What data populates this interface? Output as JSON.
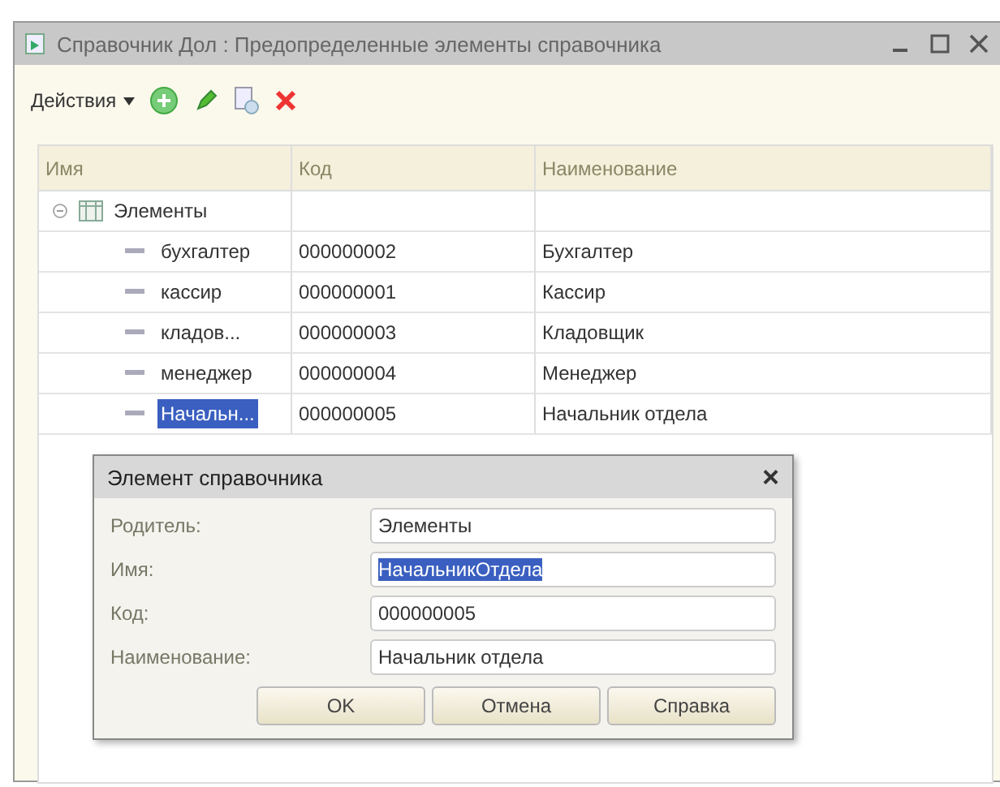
{
  "window": {
    "title": "Справочник Дол : Предопределенные элементы справочника"
  },
  "toolbar": {
    "actions_label": "Действия"
  },
  "table": {
    "columns": [
      "Имя",
      "Код",
      "Наименование"
    ],
    "tree": [
      {
        "name": "Элементы",
        "expanded": true,
        "selected": false,
        "children": [
          {
            "name": "бухгалтер",
            "code": "000000002",
            "title": "Бухгалтер",
            "selected": false
          },
          {
            "name": "кассир",
            "code": "000000001",
            "title": "Кассир",
            "selected": false
          },
          {
            "name": "кладов...",
            "code": "000000003",
            "title": "Кладовщик",
            "selected": false
          },
          {
            "name": "менеджер",
            "code": "000000004",
            "title": "Менеджер",
            "selected": false
          },
          {
            "name": "Начальн...",
            "code": "000000005",
            "title": "Начальник отдела",
            "selected": true
          }
        ]
      }
    ]
  },
  "dialog": {
    "title": "Элемент справочника",
    "close": "×",
    "fields": [
      {
        "label": "Родитель:",
        "value": "Элементы",
        "selected": false
      },
      {
        "label": "Имя:",
        "value": "НачальникОтдела",
        "selected": true
      },
      {
        "label": "Код:",
        "value": "000000005",
        "selected": false
      },
      {
        "label": "Наименование:",
        "value": "Начальник отдела",
        "selected": false
      }
    ],
    "buttons": [
      "OK",
      "Отмена",
      "Справка"
    ]
  }
}
